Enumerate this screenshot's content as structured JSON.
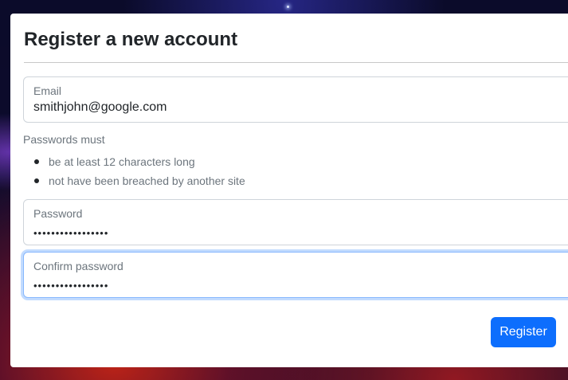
{
  "form": {
    "title": "Register a new account",
    "email": {
      "label": "Email",
      "value": "smithjohn@google.com"
    },
    "password_rules": {
      "heading": "Passwords must",
      "items": [
        "be at least 12 characters long",
        "not have been breached by another site"
      ]
    },
    "password": {
      "label": "Password",
      "masked_value": "•••••••••••••••••"
    },
    "confirm_password": {
      "label": "Confirm password",
      "masked_value": "•••••••••••••••••"
    },
    "register_label": "Register"
  },
  "colors": {
    "primary": "#0d6efd",
    "focus_border": "#86b7fe",
    "muted_text": "#6c757d",
    "text": "#212529"
  }
}
